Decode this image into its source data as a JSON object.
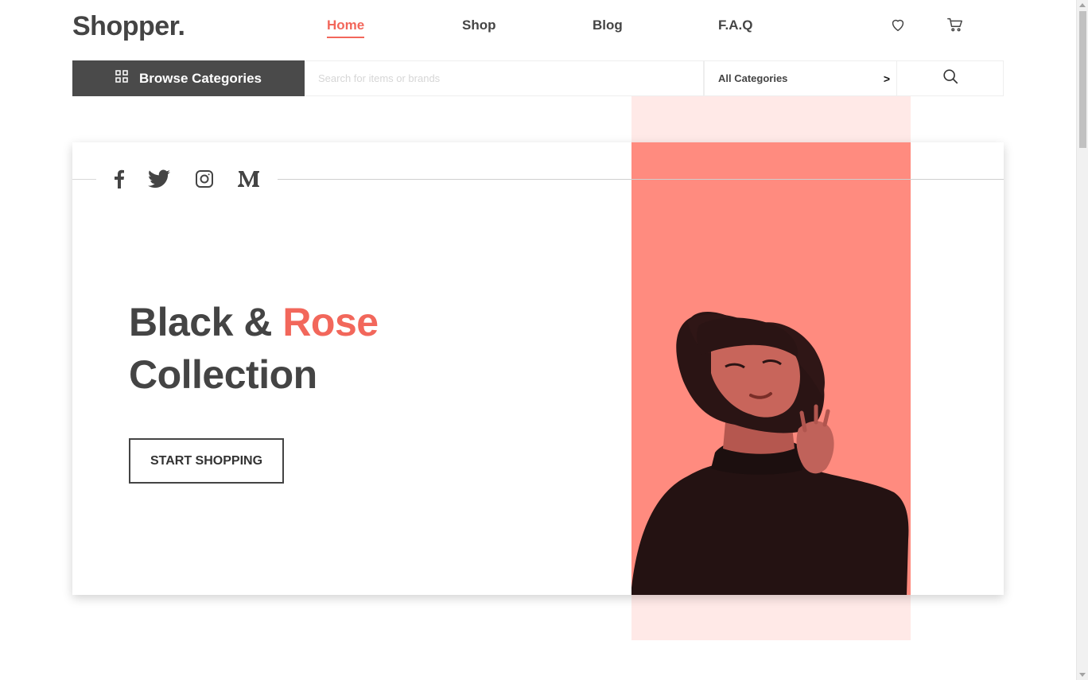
{
  "brand": {
    "logo": "Shopper."
  },
  "nav": {
    "items": [
      {
        "label": "Home",
        "active": true
      },
      {
        "label": "Shop",
        "active": false
      },
      {
        "label": "Blog",
        "active": false
      },
      {
        "label": "F.A.Q",
        "active": false
      }
    ]
  },
  "header_icons": [
    "heart-icon",
    "cart-icon"
  ],
  "search": {
    "browse_label": "Browse Categories",
    "placeholder": "Search for items or brands",
    "value": "",
    "category": "All Categories",
    "category_chevron": ">"
  },
  "social": [
    "facebook-icon",
    "twitter-icon",
    "instagram-icon",
    "medium-icon"
  ],
  "hero": {
    "title_part1": "Black & ",
    "title_accent": "Rose",
    "title_part2": "Collection",
    "cta_label": "START SHOPPING"
  },
  "colors": {
    "accent": "#f2675b",
    "dark": "#4a4a4a",
    "photo_bg": "#ff8b7f",
    "strip_bg": "#ffe9e7"
  }
}
